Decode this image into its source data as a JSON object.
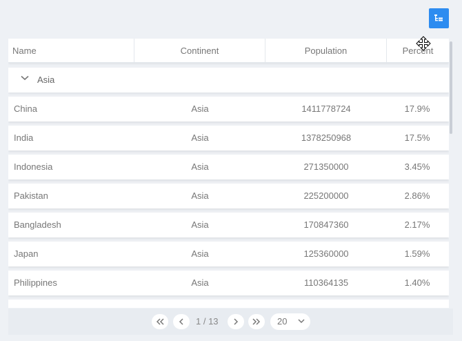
{
  "toolbar": {
    "group_button_icon": "tree-group-icon",
    "accent": "#2d8cf0"
  },
  "columns": {
    "name": "Name",
    "continent": "Continent",
    "population": "Population",
    "percent": "Percent"
  },
  "group": {
    "label": "Asia",
    "icon": "chevron-down-icon"
  },
  "rows": [
    {
      "name": "China",
      "continent": "Asia",
      "population": "1411778724",
      "percent": "17.9%"
    },
    {
      "name": "India",
      "continent": "Asia",
      "population": "1378250968",
      "percent": "17.5%"
    },
    {
      "name": "Indonesia",
      "continent": "Asia",
      "population": "271350000",
      "percent": "3.45%"
    },
    {
      "name": "Pakistan",
      "continent": "Asia",
      "population": "225200000",
      "percent": "2.86%"
    },
    {
      "name": "Bangladesh",
      "continent": "Asia",
      "population": "170847360",
      "percent": "2.17%"
    },
    {
      "name": "Japan",
      "continent": "Asia",
      "population": "125360000",
      "percent": "1.59%"
    },
    {
      "name": "Philippines",
      "continent": "Asia",
      "population": "110364135",
      "percent": "1.40%"
    }
  ],
  "pager": {
    "page_info": "1 / 13",
    "page_size": "20",
    "icons": [
      "double-chevron-left-icon",
      "chevron-left-icon",
      "chevron-right-icon",
      "double-chevron-right-icon",
      "chevron-down-icon"
    ]
  }
}
